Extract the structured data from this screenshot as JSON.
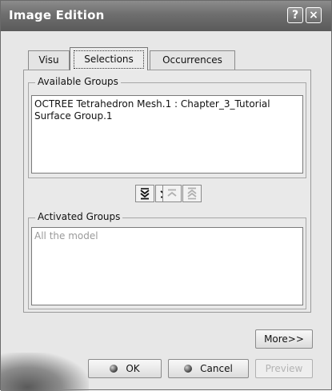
{
  "window": {
    "title": "Image Edition",
    "help_glyph": "?",
    "close_glyph": "×"
  },
  "tabs": [
    {
      "label": "Visu",
      "active": false
    },
    {
      "label": "Selections",
      "active": true
    },
    {
      "label": "Occurrences",
      "active": false
    }
  ],
  "available_groups": {
    "label": "Available Groups",
    "items": [
      "OCTREE Tetrahedron Mesh.1 : Chapter_3_Tutorial",
      "Surface Group.1"
    ]
  },
  "activated_groups": {
    "label": "Activated Groups",
    "placeholder": "All the model"
  },
  "move_buttons": [
    {
      "name": "move-all-down",
      "enabled": true
    },
    {
      "name": "move-selected-down",
      "enabled": true
    },
    {
      "name": "move-selected-up",
      "enabled": false
    },
    {
      "name": "move-all-up",
      "enabled": false
    }
  ],
  "buttons": {
    "more": "More>>",
    "ok": "OK",
    "cancel": "Cancel",
    "preview": "Preview"
  },
  "colors": {
    "titlebar": "#6e6e6e",
    "background": "#e7e7e7",
    "disabled_text": "#b4b4b4"
  }
}
